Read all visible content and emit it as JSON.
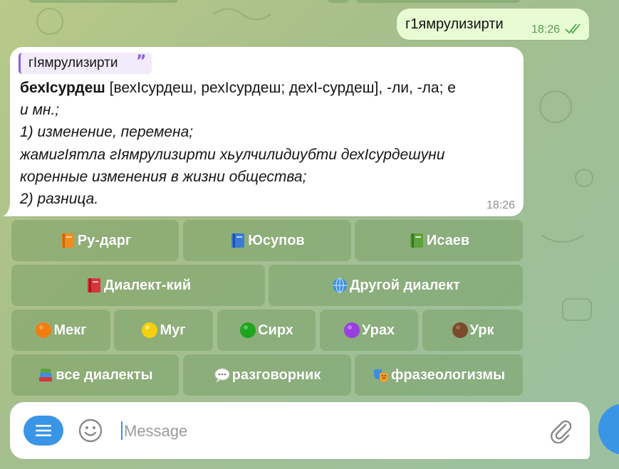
{
  "chat": {
    "outgoing": {
      "text": "г1ямрулизирти",
      "time": "18:26",
      "status_icon": "double-check-icon"
    },
    "incoming": {
      "quote": "гIямрулизирти",
      "headword": "бехIсурдеш",
      "forms": " [вехIсурдеш, рехIсурдеш; дехI-сурдеш], -ли, -ла; е",
      "line2": "и мн.;",
      "line3": "1) изменение, перемена;",
      "line4": "жамигIятла гIямрулизирти хьулчилидиубти дехIсурдешуни",
      "line5": "коренные изменения в жизни общества;",
      "line6": "2) разница.",
      "time": "18:26"
    }
  },
  "keyboard": {
    "row1": [
      {
        "emoji": "orange-book-icon",
        "label": "Ру-дарг"
      },
      {
        "emoji": "blue-book-icon",
        "label": "Юсупов"
      },
      {
        "emoji": "green-book-icon",
        "label": "Исаев"
      }
    ],
    "row2": [
      {
        "emoji": "red-book-icon",
        "label": "Диалект-кий"
      },
      {
        "emoji": "globe-icon",
        "label": "Другой диалект"
      }
    ],
    "row3": [
      {
        "emoji": "orange-circle-icon",
        "label": "Мекг"
      },
      {
        "emoji": "yellow-circle-icon",
        "label": "Муг"
      },
      {
        "emoji": "green-circle-icon",
        "label": "Сирх"
      },
      {
        "emoji": "purple-circle-icon",
        "label": "Урах"
      },
      {
        "emoji": "brown-circle-icon",
        "label": "Урк"
      }
    ],
    "row4": [
      {
        "emoji": "books-icon",
        "label": "все диалекты"
      },
      {
        "emoji": "speech-balloon-icon",
        "label": "разговорник"
      },
      {
        "emoji": "theater-masks-icon",
        "label": "фразеологизмы"
      }
    ]
  },
  "input": {
    "placeholder": "Message"
  },
  "colors": {
    "accent": "#3a95e6",
    "outgoing_bubble": "#e7fcd3",
    "quote_accent": "#8c5dd6"
  }
}
